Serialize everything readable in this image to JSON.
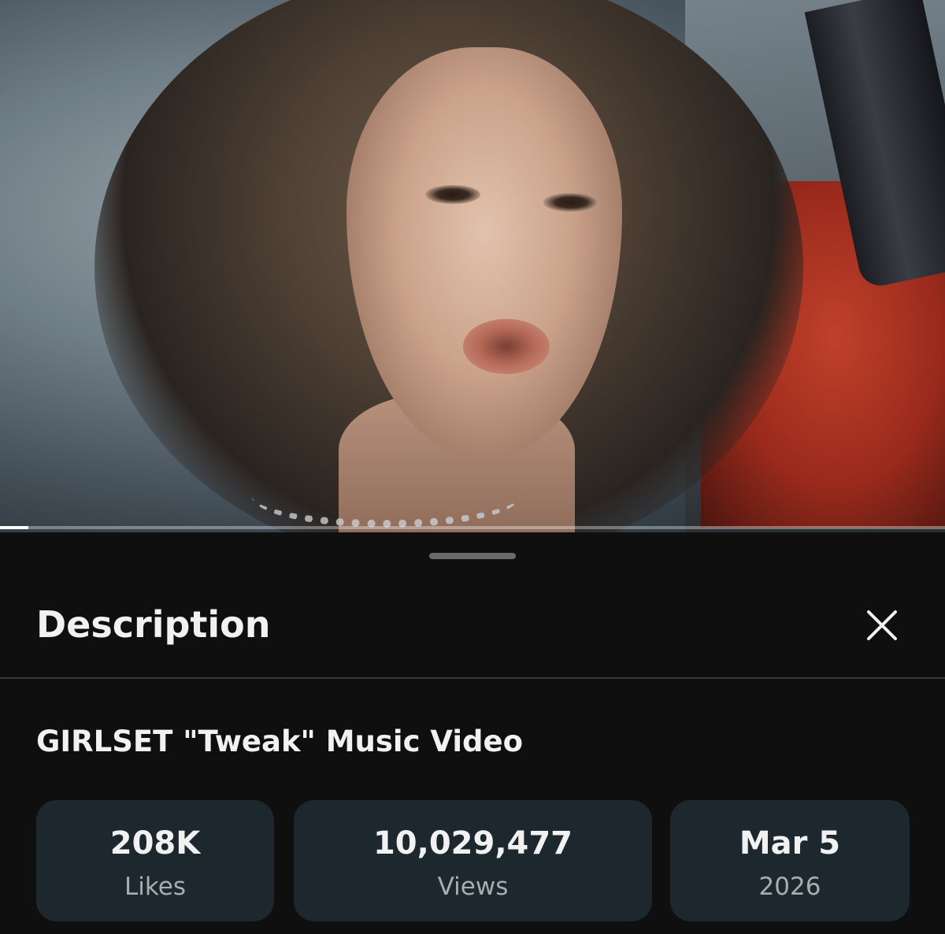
{
  "video": {
    "progress": 0.03
  },
  "description_panel": {
    "header_title": "Description",
    "close_icon": "close-icon",
    "video_title": "GIRLSET \"Tweak\" Music Video",
    "stats": {
      "likes_value": "208K",
      "likes_label": "Likes",
      "views_value": "10,029,477",
      "views_label": "Views",
      "date_value": "Mar 5",
      "date_label": "2026"
    }
  },
  "colors": {
    "background": "#0f0f0f",
    "stat_card": "#1d282e",
    "primary_text": "#f1f1f1",
    "secondary_text": "#a7adb1"
  }
}
